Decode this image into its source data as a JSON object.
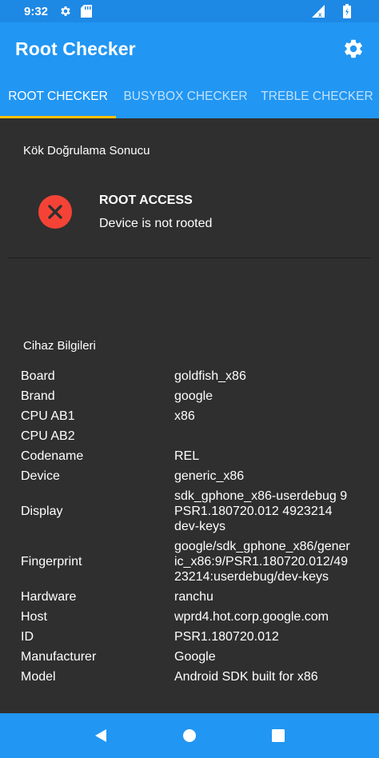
{
  "status_bar": {
    "time": "9:32",
    "icons": [
      "gear-icon",
      "sd-card-icon",
      "signal-icon",
      "battery-icon"
    ]
  },
  "app_bar": {
    "title": "Root Checker",
    "settings_icon": "gear-icon"
  },
  "tabs": [
    {
      "label": "ROOT CHECKER",
      "active": true
    },
    {
      "label": "BUSYBOX CHECKER",
      "active": false
    },
    {
      "label": "TREBLE CHECKER",
      "active": false
    }
  ],
  "root_section": {
    "label": "Kök Doğrulama Sonucu",
    "result_title": "ROOT ACCESS",
    "result_subtitle": "Device is not rooted",
    "result_icon": "error-x-icon"
  },
  "device_section": {
    "label": "Cihaz Bilgileri",
    "rows": [
      {
        "key": "Board",
        "value": "goldfish_x86"
      },
      {
        "key": "Brand",
        "value": "google"
      },
      {
        "key": "CPU AB1",
        "value": "x86"
      },
      {
        "key": "CPU AB2",
        "value": ""
      },
      {
        "key": "Codename",
        "value": "REL"
      },
      {
        "key": "Device",
        "value": "generic_x86"
      },
      {
        "key": "Display",
        "value": "sdk_gphone_x86-userdebug 9 PSR1.180720.012 4923214 dev-keys"
      },
      {
        "key": "Fingerprint",
        "value": "google/sdk_gphone_x86/generic_x86:9/PSR1.180720.012/4923214:userdebug/dev-keys"
      },
      {
        "key": "Hardware",
        "value": "ranchu"
      },
      {
        "key": "Host",
        "value": "wprd4.hot.corp.google.com"
      },
      {
        "key": "ID",
        "value": "PSR1.180720.012"
      },
      {
        "key": "Manufacturer",
        "value": "Google"
      },
      {
        "key": "Model",
        "value": "Android SDK built for x86"
      }
    ]
  },
  "nav_bar": {
    "buttons": [
      "back-icon",
      "home-icon",
      "recents-icon"
    ]
  },
  "colors": {
    "primary": "#2196f3",
    "status_bar": "#1e88e5",
    "background": "#2f2f2f",
    "tab_indicator": "#ffc107",
    "error": "#f44336"
  }
}
